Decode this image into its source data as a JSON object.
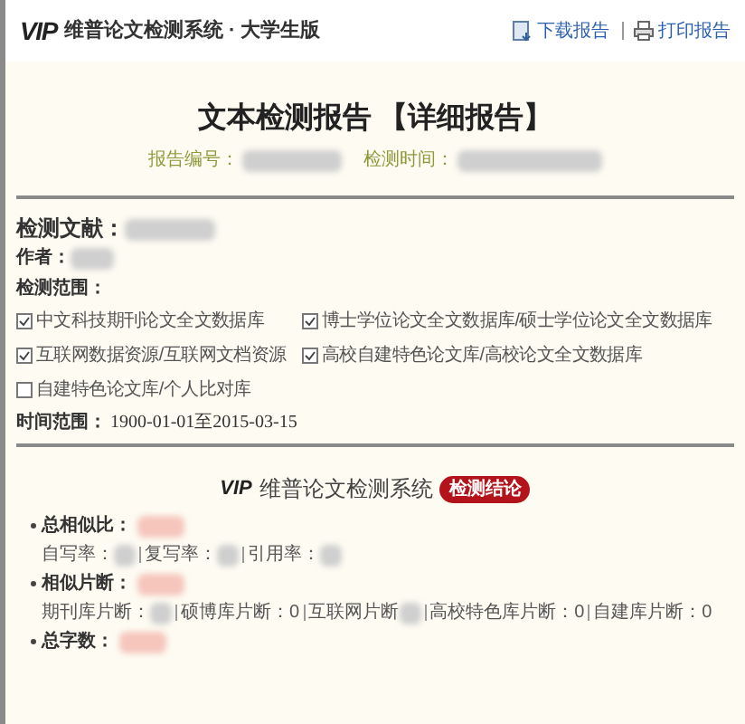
{
  "header": {
    "logo_mark": "VIP",
    "logo_text": "维普论文检测系统 · 大学生版",
    "actions": [
      {
        "kind": "download",
        "label": "下载报告"
      },
      {
        "kind": "print",
        "label": "打印报告"
      }
    ]
  },
  "title": "文本检测报告 【详细报告】",
  "meta": [
    {
      "label": "报告编号："
    },
    {
      "label": "检测时间："
    }
  ],
  "info": {
    "document_label": "检测文献：",
    "author_label": "作者：",
    "scope_label": "检测范围：",
    "scopes": [
      {
        "label": "中文科技期刊论文全文数据库",
        "checked": true
      },
      {
        "label": "博士学位论文全文数据库/硕士学位论文全文数据库",
        "checked": true
      },
      {
        "label": "互联网数据资源/互联网文档资源",
        "checked": true
      },
      {
        "label": "高校自建特色论文库/高校论文全文数据库",
        "checked": true
      },
      {
        "label": "自建特色论文库/个人比对库",
        "checked": false
      }
    ],
    "time_label": "时间范围：",
    "time_value": "1900-01-01至2015-03-15"
  },
  "conclusion": {
    "logo_mark": "VIP",
    "system": "维普论文检测系统",
    "badge": "检测结论",
    "items": [
      {
        "label": "总相似比：",
        "details": [
          {
            "label": "自写率："
          },
          {
            "label": "复写率："
          },
          {
            "label": "引用率："
          }
        ]
      },
      {
        "label": "相似片断：",
        "details": [
          {
            "label": "期刊库片断："
          },
          {
            "label": "硕博库片断：",
            "value": "0"
          },
          {
            "label": "互联网片断"
          },
          {
            "label": "高校特色库片断：",
            "value": "0"
          },
          {
            "label": "自建库片断：",
            "value": "0"
          }
        ]
      },
      {
        "label": "总字数："
      }
    ]
  }
}
